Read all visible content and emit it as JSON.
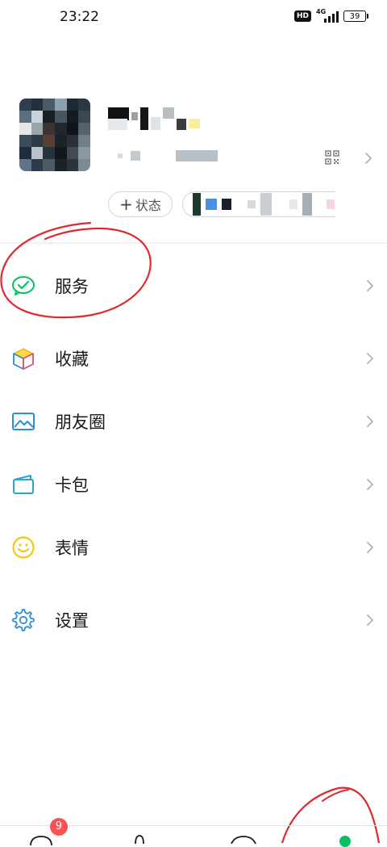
{
  "status_bar": {
    "time": "23:22",
    "hd": "HD",
    "network": "4G",
    "battery": "39"
  },
  "profile": {
    "status_button": "状态"
  },
  "menu": [
    {
      "label": "服务",
      "icon": "wechat-pay-icon"
    },
    {
      "label": "收藏",
      "icon": "favorites-cube-icon"
    },
    {
      "label": "朋友圈",
      "icon": "moments-photo-icon"
    },
    {
      "label": "卡包",
      "icon": "card-wallet-icon"
    },
    {
      "label": "表情",
      "icon": "sticker-smile-icon"
    },
    {
      "label": "设置",
      "icon": "settings-gear-icon"
    }
  ],
  "tabbar": {
    "chats_badge": "9"
  },
  "colors": {
    "accent_green": "#07c160",
    "badge_red": "#fa5151",
    "annotation_red": "#e0282e",
    "icon_blue": "#2a8ed8",
    "icon_yellow": "#f5c518"
  }
}
